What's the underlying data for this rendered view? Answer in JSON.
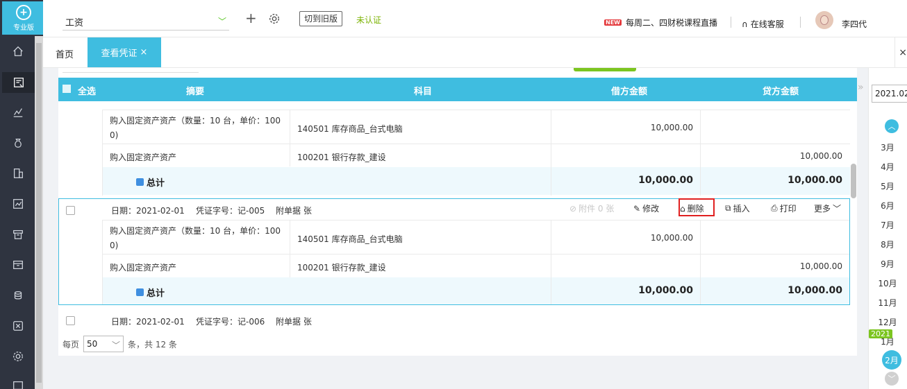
{
  "app": {
    "logo_text": "专业版"
  },
  "topbar": {
    "company": "工资",
    "old_version_btn": "切到旧版",
    "cert_status": "未认证",
    "live_badge": "NEW",
    "live_text": "每周二、四财税课程直播",
    "service": "在线客服",
    "user_name": "李四代"
  },
  "tabs": {
    "home": "首页",
    "active": "查看凭证",
    "close": "×",
    "right_close": "×"
  },
  "table": {
    "select_all": "全选",
    "columns": [
      "摘要",
      "科目",
      "借方金额",
      "贷方金额"
    ]
  },
  "vouchers": [
    {
      "rows": [
        {
          "summary_1": "购入固定资产资产（数量：10 台，单价：100",
          "summary_2": "0)",
          "account": "140501 库存商品_台式电脑",
          "debit": "10,000.00",
          "credit": ""
        },
        {
          "summary_1": "购入固定资产资产",
          "summary_2": "",
          "account": "100201 银行存款_建设",
          "debit": "",
          "credit": "10,000.00"
        }
      ],
      "total_label": "总计",
      "total_debit": "10,000.00",
      "total_credit": "10,000.00"
    },
    {
      "date_label": "日期：2021-02-01",
      "number_label": "凭证字号：记-005",
      "attach_label": "附单据  张",
      "rows": [
        {
          "summary_1": "购入固定资产资产（数量：10 台，单价：100",
          "summary_2": "0)",
          "account": "140501 库存商品_台式电脑",
          "debit": "10,000.00",
          "credit": ""
        },
        {
          "summary_1": "购入固定资产资产",
          "summary_2": "",
          "account": "100201 银行存款_建设",
          "debit": "",
          "credit": "10,000.00"
        }
      ],
      "total_label": "总计",
      "total_debit": "10,000.00",
      "total_credit": "10,000.00"
    },
    {
      "date_label": "日期：2021-02-01",
      "number_label": "凭证字号：记-006",
      "attach_label": "附单据  张"
    }
  ],
  "actions": {
    "attachments": "附件 0 张",
    "edit": "修改",
    "delete": "删除",
    "insert": "插入",
    "print": "打印",
    "more": "更多"
  },
  "pager": {
    "per_page_label": "每页",
    "per_page": "50",
    "total_text": "条，共 12 条"
  },
  "dates": {
    "year_input": "2021.02",
    "months": [
      "3月",
      "4月",
      "5月",
      "6月",
      "7月",
      "8月",
      "9月",
      "10月",
      "11月",
      "12月",
      "1月"
    ],
    "year_badge": "2021",
    "active_month": "2月"
  },
  "colors": {
    "accent": "#3fbde0",
    "sidebar": "#2f3440",
    "green": "#7cc520",
    "delete_highlight": "#e02020"
  }
}
